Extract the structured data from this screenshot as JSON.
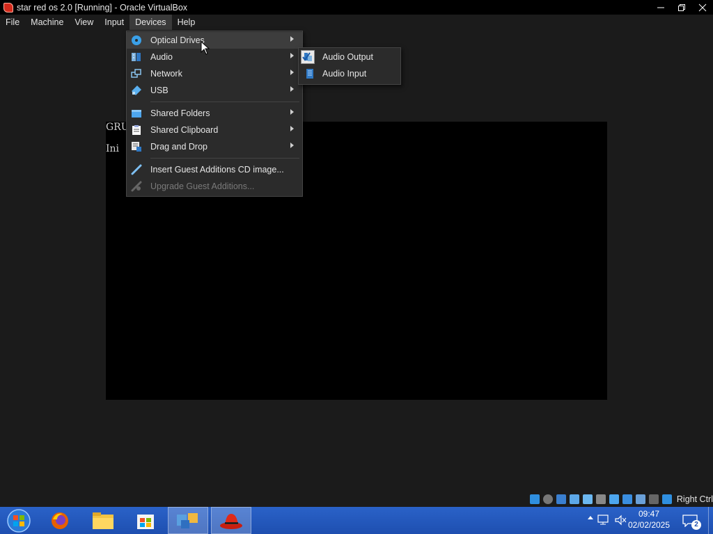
{
  "window": {
    "title": "star red os 2.0 [Running] - Oracle VirtualBox"
  },
  "menubar": {
    "items": [
      "File",
      "Machine",
      "View",
      "Input",
      "Devices",
      "Help"
    ]
  },
  "vm_screen": {
    "line1": "GRUI",
    "line2": "Ini"
  },
  "devices_menu": {
    "items": [
      {
        "label": "Optical Drives",
        "icon": "optical-disc-icon"
      },
      {
        "label": "Audio",
        "icon": "audio-icon"
      },
      {
        "label": "Network",
        "icon": "network-icon"
      },
      {
        "label": "USB",
        "icon": "usb-icon"
      },
      {
        "label": "Shared Folders",
        "icon": "shared-folders-icon"
      },
      {
        "label": "Shared Clipboard",
        "icon": "shared-clipboard-icon"
      },
      {
        "label": "Drag and Drop",
        "icon": "drag-and-drop-icon"
      },
      {
        "label": "Insert Guest Additions CD image...",
        "icon": "guest-additions-icon"
      },
      {
        "label": "Upgrade Guest Additions...",
        "icon": "upgrade-guest-additions-icon",
        "disabled": true
      }
    ]
  },
  "audio_submenu": {
    "items": [
      {
        "label": "Audio Output",
        "checked": true
      },
      {
        "label": "Audio Input",
        "checked": false
      }
    ]
  },
  "statusbar": {
    "host_key": "Right Ctrl"
  },
  "taskbar": {
    "time": "09:47",
    "date": "02/02/2025",
    "notifications": "2"
  },
  "colors": {
    "taskbar": "#1e4fb0",
    "menu_bg": "#2b2b2b",
    "window_bg": "#1b1b1b"
  }
}
